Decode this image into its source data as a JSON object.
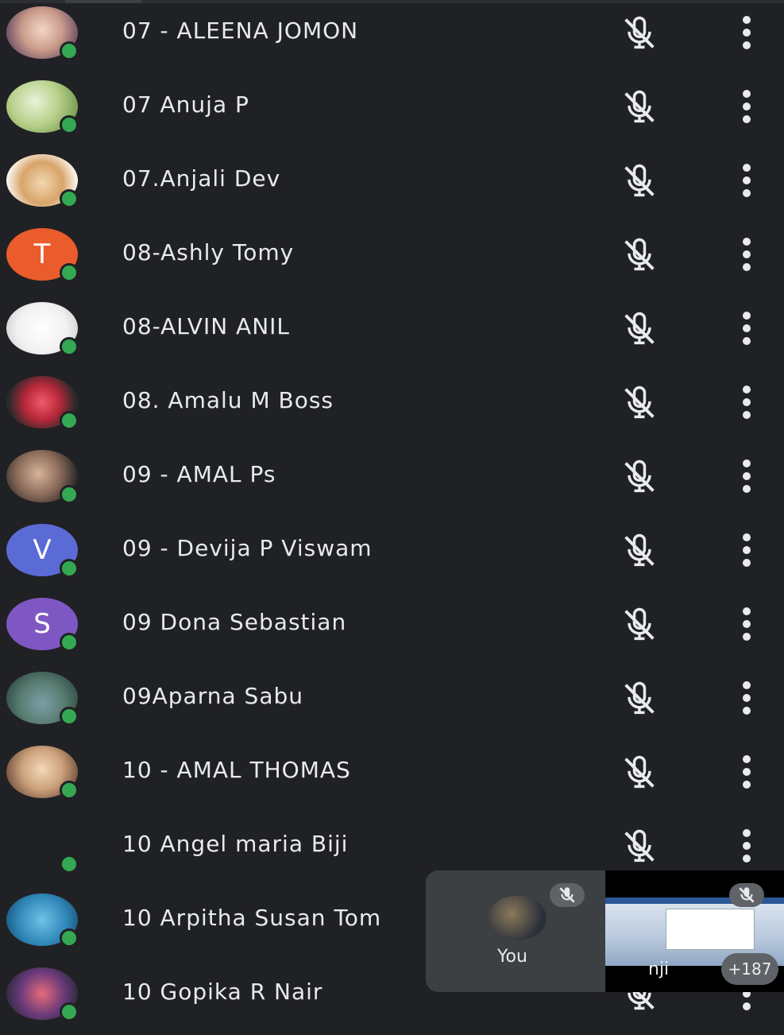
{
  "participants": [
    {
      "name": "07 - ALEENA JOMON",
      "avatar": {
        "type": "photo",
        "fill": "radial-gradient(circle at 50% 45%, #f3d5c5 0%, #c99a8a 45%, #7a5a6a 75%)"
      }
    },
    {
      "name": "07 Anuja P",
      "avatar": {
        "type": "photo",
        "fill": "radial-gradient(circle at 40% 40%, #eaf2d8 0%, #b7d08a 45%, #7c9f55 80%)"
      }
    },
    {
      "name": "07.Anjali Dev",
      "avatar": {
        "type": "photo",
        "fill": "radial-gradient(circle at 50% 55%, #f2d7b0 0%, #d8a46a 45%, #ffffff 80%)"
      }
    },
    {
      "name": "08-Ashly Tomy",
      "avatar": {
        "type": "letter",
        "letter": "T",
        "color": "#ea5c2c"
      }
    },
    {
      "name": "08-ALVIN ANIL",
      "avatar": {
        "type": "photo",
        "fill": "radial-gradient(circle at 50% 50%, #ffffff 0%, #f1f1f1 55%, #d0d0d0 90%)"
      }
    },
    {
      "name": "08. Amalu M Boss",
      "avatar": {
        "type": "photo",
        "fill": "radial-gradient(circle at 50% 50%, #f05a6a 0%, #b8283a 40%, #2a2a2a 75%)"
      }
    },
    {
      "name": "09 - AMAL Ps",
      "avatar": {
        "type": "photo",
        "fill": "radial-gradient(circle at 45% 45%, #d6b39a 0%, #8a6a58 45%, #2a2a2a 80%)"
      }
    },
    {
      "name": "09 - Devija P Viswam",
      "avatar": {
        "type": "letter",
        "letter": "V",
        "color": "#5b6bd6"
      }
    },
    {
      "name": "09 Dona Sebastian",
      "avatar": {
        "type": "letter",
        "letter": "S",
        "color": "#7e57c2"
      }
    },
    {
      "name": "09Aparna Sabu",
      "avatar": {
        "type": "photo",
        "fill": "radial-gradient(circle at 50% 60%, #7aa0a8 0%, #5a7e72 45%, #2f4a44 85%)"
      }
    },
    {
      "name": "10 - AMAL THOMAS",
      "avatar": {
        "type": "photo",
        "fill": "radial-gradient(circle at 50% 45%, #f5d9b8 0%, #caa07a 45%, #6b4a3a 85%)"
      }
    },
    {
      "name": "10 Angel maria Biji",
      "avatar": {
        "type": "none"
      }
    },
    {
      "name": "10 Arpitha Susan Tom",
      "avatar": {
        "type": "photo",
        "fill": "radial-gradient(circle at 50% 50%, #6fc3e8 0%, #2f86b8 55%, #1d5a80 85%)"
      }
    },
    {
      "name": "10 Gopika R Nair",
      "avatar": {
        "type": "photo",
        "fill": "radial-gradient(circle at 50% 50%, #e46b7a 0%, #6a3a7a 50%, #2a2a3a 85%)"
      }
    }
  ],
  "self_tile": {
    "label": "You"
  },
  "screen_tile": {
    "caption": "nji",
    "count": "+187"
  },
  "icons": {
    "row_mic": "mic-off-icon",
    "row_more": "more-vert-icon"
  }
}
